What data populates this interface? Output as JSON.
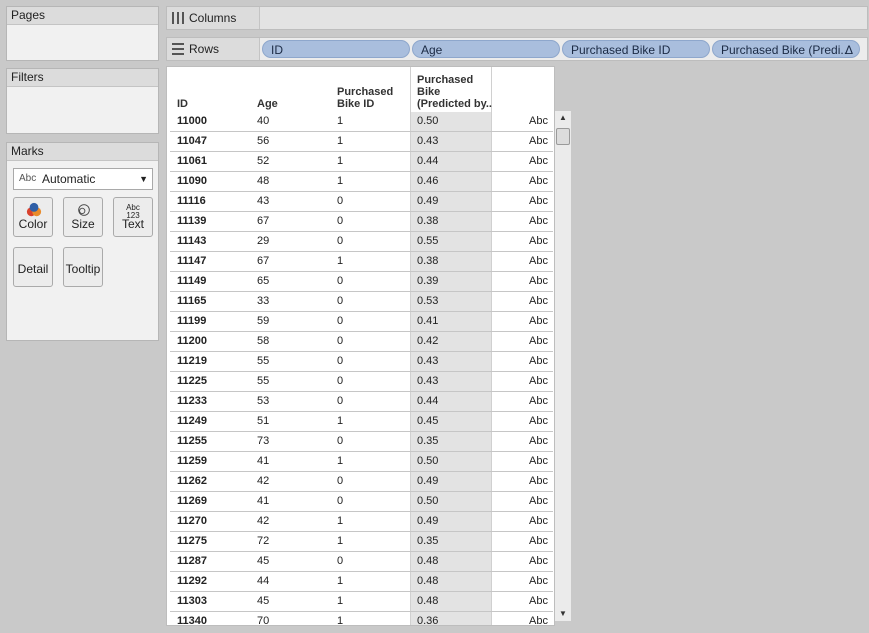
{
  "cards": {
    "pages_title": "Pages",
    "filters_title": "Filters",
    "marks_title": "Marks"
  },
  "marks": {
    "type_icon_text": "Abc",
    "type": "Automatic",
    "buttons": {
      "color": "Color",
      "size": "Size",
      "text": "Text",
      "text_icon_top": "Abc",
      "text_icon_bottom": "123",
      "detail": "Detail",
      "tooltip": "Tooltip"
    }
  },
  "shelves": {
    "columns_label": "Columns",
    "rows_label": "Rows",
    "pills": [
      "ID",
      "Age",
      "Purchased Bike ID",
      "Purchased Bike (Predi.."
    ],
    "delta_symbol": "Δ"
  },
  "table": {
    "headers": {
      "id": "ID",
      "age": "Age",
      "pb_line1": "Purchased",
      "pb_line2": "Bike ID",
      "pred_line1": "Purchased",
      "pred_line2": "Bike",
      "pred_line3": "(Predicted by.."
    },
    "rows": [
      {
        "id": "11000",
        "age": "40",
        "pb": "1",
        "pred": "0.50",
        "abc": "Abc"
      },
      {
        "id": "11047",
        "age": "56",
        "pb": "1",
        "pred": "0.43",
        "abc": "Abc"
      },
      {
        "id": "11061",
        "age": "52",
        "pb": "1",
        "pred": "0.44",
        "abc": "Abc"
      },
      {
        "id": "11090",
        "age": "48",
        "pb": "1",
        "pred": "0.46",
        "abc": "Abc"
      },
      {
        "id": "11116",
        "age": "43",
        "pb": "0",
        "pred": "0.49",
        "abc": "Abc"
      },
      {
        "id": "11139",
        "age": "67",
        "pb": "0",
        "pred": "0.38",
        "abc": "Abc"
      },
      {
        "id": "11143",
        "age": "29",
        "pb": "0",
        "pred": "0.55",
        "abc": "Abc"
      },
      {
        "id": "11147",
        "age": "67",
        "pb": "1",
        "pred": "0.38",
        "abc": "Abc"
      },
      {
        "id": "11149",
        "age": "65",
        "pb": "0",
        "pred": "0.39",
        "abc": "Abc"
      },
      {
        "id": "11165",
        "age": "33",
        "pb": "0",
        "pred": "0.53",
        "abc": "Abc"
      },
      {
        "id": "11199",
        "age": "59",
        "pb": "0",
        "pred": "0.41",
        "abc": "Abc"
      },
      {
        "id": "11200",
        "age": "58",
        "pb": "0",
        "pred": "0.42",
        "abc": "Abc"
      },
      {
        "id": "11219",
        "age": "55",
        "pb": "0",
        "pred": "0.43",
        "abc": "Abc"
      },
      {
        "id": "11225",
        "age": "55",
        "pb": "0",
        "pred": "0.43",
        "abc": "Abc"
      },
      {
        "id": "11233",
        "age": "53",
        "pb": "0",
        "pred": "0.44",
        "abc": "Abc"
      },
      {
        "id": "11249",
        "age": "51",
        "pb": "1",
        "pred": "0.45",
        "abc": "Abc"
      },
      {
        "id": "11255",
        "age": "73",
        "pb": "0",
        "pred": "0.35",
        "abc": "Abc"
      },
      {
        "id": "11259",
        "age": "41",
        "pb": "1",
        "pred": "0.50",
        "abc": "Abc"
      },
      {
        "id": "11262",
        "age": "42",
        "pb": "0",
        "pred": "0.49",
        "abc": "Abc"
      },
      {
        "id": "11269",
        "age": "41",
        "pb": "0",
        "pred": "0.50",
        "abc": "Abc"
      },
      {
        "id": "11270",
        "age": "42",
        "pb": "1",
        "pred": "0.49",
        "abc": "Abc"
      },
      {
        "id": "11275",
        "age": "72",
        "pb": "1",
        "pred": "0.35",
        "abc": "Abc"
      },
      {
        "id": "11287",
        "age": "45",
        "pb": "0",
        "pred": "0.48",
        "abc": "Abc"
      },
      {
        "id": "11292",
        "age": "44",
        "pb": "1",
        "pred": "0.48",
        "abc": "Abc"
      },
      {
        "id": "11303",
        "age": "45",
        "pb": "1",
        "pred": "0.48",
        "abc": "Abc"
      },
      {
        "id": "11340",
        "age": "70",
        "pb": "1",
        "pred": "0.36",
        "abc": "Abc"
      }
    ]
  },
  "scrollbar": {
    "up_icon": "▲",
    "down_icon": "▼"
  }
}
